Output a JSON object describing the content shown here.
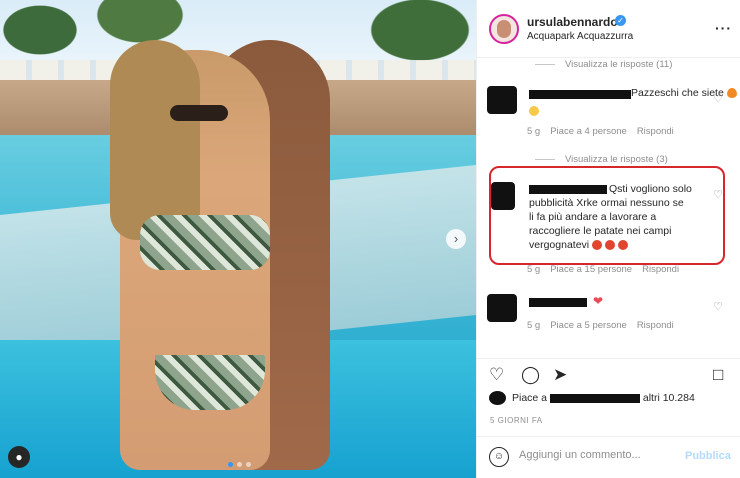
{
  "post": {
    "username": "ursulabennardo",
    "location": "Acquapark Acquazzurra",
    "more_icon": "more-dots-icon",
    "verified_icon": "verified-badge-icon"
  },
  "comments": [
    {
      "replies_label": "Visualizza le risposte (11)"
    },
    {
      "text": "Pazzeschi che siete",
      "time": "5 g",
      "likes": "Piace a 4 persone",
      "reply": "Rispondi",
      "replies_label": "Visualizza le risposte (3)"
    },
    {
      "text_lines": [
        "Qsti vogliono solo",
        "pubblicità Xrke ormai nessuno se",
        "li fa più andare a lavorare a",
        "raccogliere le patate nei campi",
        "vergognatevi"
      ],
      "time": "5 g",
      "likes": "Piace a 15 persone",
      "reply": "Rispondi"
    },
    {
      "time": "5 g",
      "likes": "Piace a 5 persone",
      "reply": "Rispondi"
    }
  ],
  "actions": {
    "like_icon": "heart-icon",
    "comment_icon": "comment-icon",
    "share_icon": "paper-plane-icon",
    "save_icon": "bookmark-icon"
  },
  "likes_line": {
    "prefix": "Piace a",
    "suffix": "altri 10.284"
  },
  "date": "5 GIORNI FA",
  "composer": {
    "placeholder": "Aggiungi un commento...",
    "post_label": "Pubblica",
    "emoji_icon": "smile-icon"
  },
  "colors": {
    "highlight_border": "#d7262e",
    "link_blue_disabled": "#b3dbff",
    "verified_blue": "#3897f0"
  }
}
